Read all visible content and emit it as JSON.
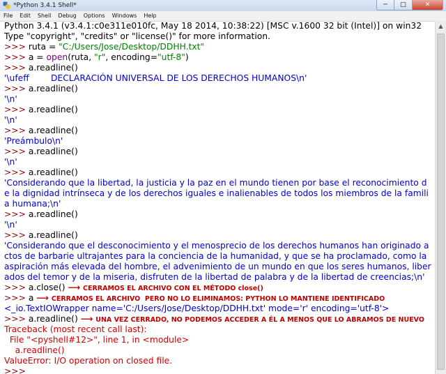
{
  "window": {
    "title": "*Python 3.4.1 Shell*",
    "buttons": {
      "minimize": "─",
      "maximize": "□",
      "close": "✕"
    }
  },
  "menubar": [
    "File",
    "Edit",
    "Shell",
    "Debug",
    "Options",
    "Windows",
    "Help"
  ],
  "shell": {
    "header": [
      "Python 3.4.1 (v3.4.1:c0e311e010fc, May 18 2014, 10:38:22) [MSC v.1600 32 bit (Intel)] on win32",
      "Type \"copyright\", \"credits\" or \"license()\" for more information."
    ],
    "prompt": ">>> ",
    "l1": {
      "a": "ruta = ",
      "s": "\"C:/Users/Jose/Desktop/DDHH.txt\""
    },
    "l2": {
      "a": "a = ",
      "b": "open",
      "c": "(ruta, ",
      "d": "\"r\"",
      "e": ", encoding=",
      "f": "\"utf-8\"",
      "g": ")"
    },
    "readline": "a.readline()",
    "r1": "'\\ufeff        DECLARACIÓN UNIVERSAL DE LOS DERECHOS HUMANOS\\n'",
    "r2": "'\\n'",
    "r3": "'\\n'",
    "r4": "'Preámbulo\\n'",
    "r5": "'\\n'",
    "r6": [
      "'Considerando que la libertad, la justicia y la paz en el mundo tienen por base el reconocimiento d",
      "e la dignidad intrínseca y de los derechos iguales e inalienables de todos los miembros de la famili",
      "a humana;\\n'"
    ],
    "r7": "'\\n'",
    "r8": [
      "'Considerando que el desconocimiento y el menosprecio de los derechos humanos han originado a",
      "ctos de barbarie ultrajantes para la conciencia de la humanidad, y que se ha proclamado, como la",
      "aspiración más elevada del hombre, el advenimiento de un mundo en que los seres humanos, liber",
      "ados del temor y de la miseria, disfruten de la libertad de palabra y de la libertad de creencias;\\n'"
    ],
    "close_cmd": "a.close()",
    "note_close": "CERRAMOS EL ARCHIVO CON EL MÉTODO close()",
    "a_cmd": "a",
    "note_a": "CERRAMOS EL ARCHIVO  PERO NO LO ELIMINAMOS: PYTHON LO MANTIENE IDENTIFICADO",
    "wrapper": "<_io.TextIOWrapper name='C:/Users/Jose/Desktop/DDHH.txt' mode='r' encoding='utf-8'>",
    "note_readline": "UNA VEZ CERRADO, NO PODEMOS ACCEDER A ÉL A MENOS QUE LO ABRAMOS DE NUEVO",
    "arrow": "⟶",
    "traceback": [
      "Traceback (most recent call last):",
      "  File \"<pyshell#12>\", line 1, in <module>",
      "    a.readline()",
      "ValueError: I/O operation on closed file."
    ]
  },
  "scrollbar": {
    "up": "▲"
  }
}
